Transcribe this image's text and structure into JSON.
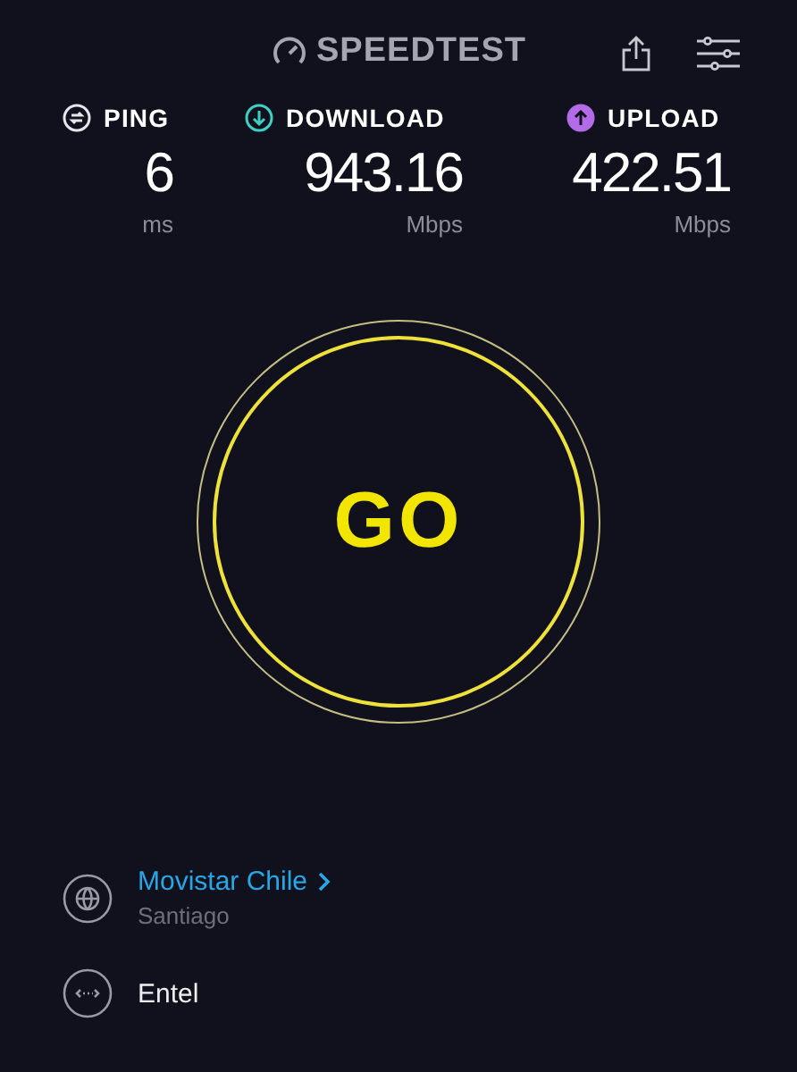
{
  "header": {
    "logo": "SPEEDTEST"
  },
  "metrics": [
    {
      "kind": "ping",
      "label": "PING",
      "value": "6",
      "unit": "ms",
      "color": "#e6e6ea"
    },
    {
      "kind": "download",
      "label": "DOWNLOAD",
      "value": "943.16",
      "unit": "Mbps",
      "color": "#3fd0c4"
    },
    {
      "kind": "upload",
      "label": "UPLOAD",
      "value": "422.51",
      "unit": "Mbps",
      "color": "#b36be8"
    }
  ],
  "go_button": {
    "label": "GO"
  },
  "server": {
    "name": "Movistar Chile",
    "location": "Santiago"
  },
  "provider": {
    "name": "Entel"
  }
}
